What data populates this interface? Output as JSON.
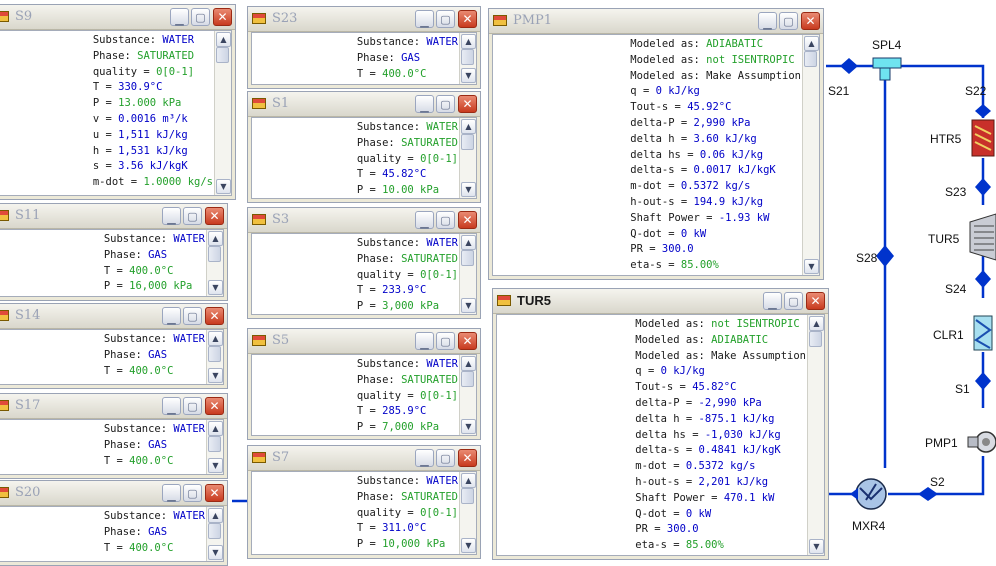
{
  "colors": {
    "stream": "#0033cc",
    "label": "#1a1a1a",
    "value_blue": "#0000c8",
    "value_green": "#23a02b",
    "close_button": "#d44a2a"
  },
  "windows": {
    "s9": {
      "title": "S9",
      "lines": [
        {
          "label": "Substance:",
          "value": "WATER",
          "color": "blue"
        },
        {
          "label": "Phase:",
          "value": "SATURATED",
          "color": "green"
        },
        {
          "label": "quality =",
          "value": "0[0-1]",
          "color": "green"
        },
        {
          "label": "T =",
          "value": "330.9°C",
          "color": "blue"
        },
        {
          "label": "P =",
          "value": "13.000 kPa",
          "color": "green"
        },
        {
          "label": "v =",
          "value": "0.0016 m³/k",
          "color": "blue"
        },
        {
          "label": "u =",
          "value": "1,511 kJ/kg",
          "color": "blue"
        },
        {
          "label": "h =",
          "value": "1,531 kJ/kg",
          "color": "blue"
        },
        {
          "label": "s =",
          "value": "3.56 kJ/kgK",
          "color": "blue"
        },
        {
          "label": "m-dot =",
          "value": "1.0000 kg/s",
          "color": "green"
        }
      ]
    },
    "s23": {
      "title": "S23",
      "lines": [
        {
          "label": "Substance:",
          "value": "WATER",
          "color": "blue"
        },
        {
          "label": "Phase:",
          "value": "GAS",
          "color": "blue"
        },
        {
          "label": "T =",
          "value": "400.0°C",
          "color": "green"
        }
      ]
    },
    "s1": {
      "title": "S1",
      "lines": [
        {
          "label": "Substance:",
          "value": "WATER",
          "color": "green"
        },
        {
          "label": "Phase:",
          "value": "SATURATED",
          "color": "green"
        },
        {
          "label": "quality =",
          "value": "0[0-1]",
          "color": "green"
        },
        {
          "label": "T =",
          "value": "45.82°C",
          "color": "blue"
        },
        {
          "label": "P =",
          "value": "10.00 kPa",
          "color": "green"
        }
      ]
    },
    "s11": {
      "title": "S11",
      "lines": [
        {
          "label": "Substance:",
          "value": "WATER",
          "color": "blue"
        },
        {
          "label": "Phase:",
          "value": "GAS",
          "color": "blue"
        },
        {
          "label": "T =",
          "value": "400.0°C",
          "color": "green"
        },
        {
          "label": "P =",
          "value": "16,000 kPa",
          "color": "green"
        }
      ]
    },
    "s3": {
      "title": "S3",
      "lines": [
        {
          "label": "Substance:",
          "value": "WATER",
          "color": "blue"
        },
        {
          "label": "Phase:",
          "value": "SATURATED",
          "color": "green"
        },
        {
          "label": "quality =",
          "value": "0[0-1]",
          "color": "green"
        },
        {
          "label": "T =",
          "value": "233.9°C",
          "color": "blue"
        },
        {
          "label": "P =",
          "value": "3,000 kPa",
          "color": "green"
        }
      ]
    },
    "s14": {
      "title": "S14",
      "lines": [
        {
          "label": "Substance:",
          "value": "WATER",
          "color": "blue"
        },
        {
          "label": "Phase:",
          "value": "GAS",
          "color": "blue"
        },
        {
          "label": "T =",
          "value": "400.0°C",
          "color": "green"
        }
      ]
    },
    "s5": {
      "title": "S5",
      "lines": [
        {
          "label": "Substance:",
          "value": "WATER",
          "color": "blue"
        },
        {
          "label": "Phase:",
          "value": "SATURATED",
          "color": "green"
        },
        {
          "label": "quality =",
          "value": "0[0-1]",
          "color": "green"
        },
        {
          "label": "T =",
          "value": "285.9°C",
          "color": "blue"
        },
        {
          "label": "P =",
          "value": "7,000 kPa",
          "color": "green"
        }
      ]
    },
    "s17": {
      "title": "S17",
      "lines": [
        {
          "label": "Substance:",
          "value": "WATER",
          "color": "blue"
        },
        {
          "label": "Phase:",
          "value": "GAS",
          "color": "blue"
        },
        {
          "label": "T =",
          "value": "400.0°C",
          "color": "green"
        }
      ]
    },
    "s20": {
      "title": "S20",
      "lines": [
        {
          "label": "Substance:",
          "value": "WATER",
          "color": "blue"
        },
        {
          "label": "Phase:",
          "value": "GAS",
          "color": "blue"
        },
        {
          "label": "T =",
          "value": "400.0°C",
          "color": "green"
        }
      ]
    },
    "s7": {
      "title": "S7",
      "lines": [
        {
          "label": "Substance:",
          "value": "WATER",
          "color": "blue"
        },
        {
          "label": "Phase:",
          "value": "SATURATED",
          "color": "green"
        },
        {
          "label": "quality =",
          "value": "0[0-1]",
          "color": "green"
        },
        {
          "label": "T =",
          "value": "311.0°C",
          "color": "blue"
        },
        {
          "label": "P =",
          "value": "10,000 kPa",
          "color": "green"
        }
      ]
    },
    "pmp1": {
      "title": "PMP1",
      "lines": [
        {
          "label": "Modeled as:",
          "value": "ADIABATIC",
          "color": "green"
        },
        {
          "label": "Modeled as:",
          "value": "not ISENTROPIC",
          "color": "green"
        },
        {
          "label": "Modeled as:",
          "value": "Make Assumption",
          "color": "black"
        },
        {
          "label": "q =",
          "value": "0 kJ/kg",
          "color": "blue"
        },
        {
          "label": "Tout-s =",
          "value": "45.92°C",
          "color": "blue"
        },
        {
          "label": "delta-P =",
          "value": "2,990 kPa",
          "color": "blue"
        },
        {
          "label": "delta h =",
          "value": "3.60 kJ/kg",
          "color": "blue"
        },
        {
          "label": "delta hs =",
          "value": "0.06 kJ/kg",
          "color": "blue"
        },
        {
          "label": "delta-s =",
          "value": "0.0017 kJ/kgK",
          "color": "blue"
        },
        {
          "label": "m-dot =",
          "value": "0.5372 kg/s",
          "color": "blue"
        },
        {
          "label": "h-out-s =",
          "value": "194.9 kJ/kg",
          "color": "blue"
        },
        {
          "label": "Shaft Power =",
          "value": "-1.93 kW",
          "color": "blue"
        },
        {
          "label": "Q-dot =",
          "value": "0 kW",
          "color": "blue"
        },
        {
          "label": "PR =",
          "value": "300.0",
          "color": "blue"
        },
        {
          "label": "eta-s =",
          "value": "85.00%",
          "color": "green"
        }
      ]
    },
    "tur5": {
      "title": "TUR5",
      "lines": [
        {
          "label": "Modeled as:",
          "value": "not ISENTROPIC",
          "color": "green"
        },
        {
          "label": "Modeled as:",
          "value": "ADIABATIC",
          "color": "green"
        },
        {
          "label": "Modeled as:",
          "value": "Make Assumption",
          "color": "black"
        },
        {
          "label": "q =",
          "value": "0 kJ/kg",
          "color": "blue"
        },
        {
          "label": "Tout-s =",
          "value": "45.82°C",
          "color": "blue"
        },
        {
          "label": "delta-P =",
          "value": "-2,990 kPa",
          "color": "blue"
        },
        {
          "label": "delta h =",
          "value": "-875.1 kJ/kg",
          "color": "blue"
        },
        {
          "label": "delta hs =",
          "value": "-1,030 kJ/kg",
          "color": "blue"
        },
        {
          "label": "delta-s =",
          "value": "0.4841 kJ/kgK",
          "color": "blue"
        },
        {
          "label": "m-dot =",
          "value": "0.5372 kg/s",
          "color": "blue"
        },
        {
          "label": "h-out-s =",
          "value": "2,201 kJ/kg",
          "color": "blue"
        },
        {
          "label": "Shaft Power =",
          "value": "470.1 kW",
          "color": "blue"
        },
        {
          "label": "Q-dot =",
          "value": "0 kW",
          "color": "blue"
        },
        {
          "label": "PR =",
          "value": "300.0",
          "color": "blue"
        },
        {
          "label": "eta-s =",
          "value": "85.00%",
          "color": "green"
        }
      ]
    }
  },
  "flowsheet": {
    "labels": {
      "spl4": "SPL4",
      "s21": "S21",
      "s22": "S22",
      "htr5": "HTR5",
      "s23": "S23",
      "tur5": "TUR5",
      "s28": "S28",
      "s24": "S24",
      "clr1": "CLR1",
      "s1": "S1",
      "pmp1": "PMP1",
      "s2": "S2",
      "mxr4": "MXR4"
    }
  }
}
